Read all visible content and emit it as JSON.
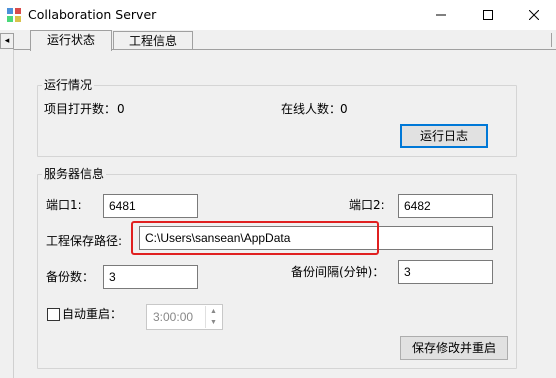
{
  "window": {
    "title": "Collaboration Server",
    "minimize_glyph": "—",
    "maximize_glyph": "☐",
    "close_glyph": "✕",
    "app_icon": "app-icon"
  },
  "tabs": {
    "scroll_left_glyph": "◂",
    "items": [
      {
        "label": "运行状态",
        "active": true
      },
      {
        "label": "工程信息",
        "active": false
      }
    ]
  },
  "run_status": {
    "group_title": "运行情况",
    "projects_open_label": "项目打开数：",
    "projects_open_value": "0",
    "online_users_label": "在线人数：",
    "online_users_value": "0",
    "run_log_button": "运行日志"
  },
  "server_info": {
    "group_title": "服务器信息",
    "port1_label": "端口1:",
    "port1_value": "6481",
    "port2_label": "端口2:",
    "port2_value": "6482",
    "save_path_label": "工程保存路径:",
    "save_path_value": "C:\\Users\\sansean\\AppData",
    "backup_count_label": "备份数：",
    "backup_count_value": "3",
    "backup_interval_label": "备份间隔(分钟)：",
    "backup_interval_value": "3",
    "auto_restart_label": "自动重启：",
    "auto_restart_checked": false,
    "restart_time_value": "3:00:00",
    "save_restart_button": "保存修改并重启"
  },
  "colors": {
    "highlight": "#e02020",
    "focus": "#0078d7"
  }
}
